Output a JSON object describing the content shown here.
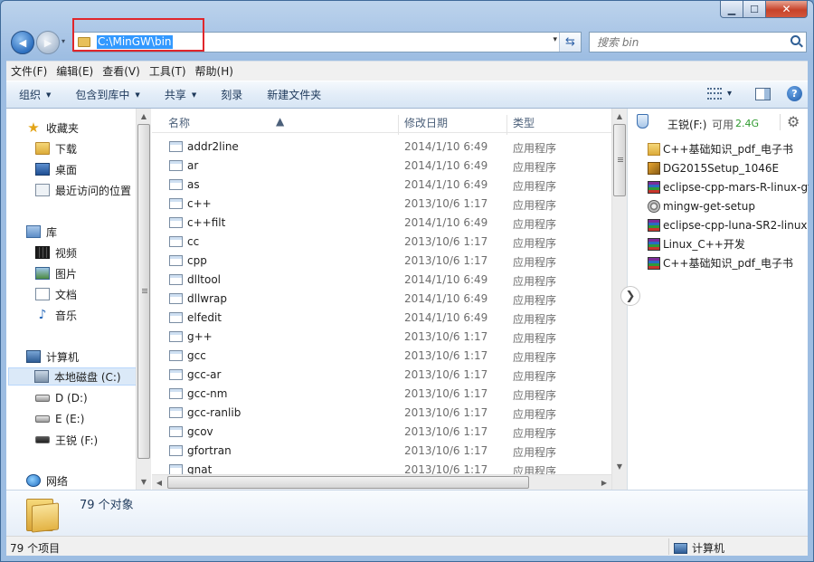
{
  "window": {
    "minimize": "▁",
    "maximize": "☐",
    "close": "✕"
  },
  "nav": {
    "back": "◀",
    "forward": "▶",
    "history": "▾",
    "address": "C:\\MinGW\\bin",
    "address_drop": "▾",
    "refresh": "⇆",
    "search_placeholder": "搜索 bin"
  },
  "menu": [
    "文件(F)",
    "编辑(E)",
    "查看(V)",
    "工具(T)",
    "帮助(H)"
  ],
  "commands": [
    {
      "label": "组织",
      "dropdown": true
    },
    {
      "label": "包含到库中",
      "dropdown": true
    },
    {
      "label": "共享",
      "dropdown": true
    },
    {
      "label": "刻录",
      "dropdown": false
    },
    {
      "label": "新建文件夹",
      "dropdown": false
    }
  ],
  "cmd_right": {
    "view_caret": "▾",
    "help": "?"
  },
  "navpane": {
    "favorites": "收藏夹",
    "downloads": "下载",
    "desktop": "桌面",
    "recent": "最近访问的位置",
    "libraries": "库",
    "videos": "视频",
    "pictures": "图片",
    "documents": "文档",
    "music": "音乐",
    "computer": "计算机",
    "drive_c": "本地磁盘 (C:)",
    "drive_d": "D (D:)",
    "drive_e": "E (E:)",
    "drive_f": "王锐 (F:)",
    "network": "网络"
  },
  "columns": {
    "name": "名称",
    "date": "修改日期",
    "type": "类型"
  },
  "files": [
    {
      "name": "addr2line",
      "date": "2014/1/10 6:49",
      "type": "应用程序"
    },
    {
      "name": "ar",
      "date": "2014/1/10 6:49",
      "type": "应用程序"
    },
    {
      "name": "as",
      "date": "2014/1/10 6:49",
      "type": "应用程序"
    },
    {
      "name": "c++",
      "date": "2013/10/6 1:17",
      "type": "应用程序"
    },
    {
      "name": "c++filt",
      "date": "2014/1/10 6:49",
      "type": "应用程序"
    },
    {
      "name": "cc",
      "date": "2013/10/6 1:17",
      "type": "应用程序"
    },
    {
      "name": "cpp",
      "date": "2013/10/6 1:17",
      "type": "应用程序"
    },
    {
      "name": "dlltool",
      "date": "2014/1/10 6:49",
      "type": "应用程序"
    },
    {
      "name": "dllwrap",
      "date": "2014/1/10 6:49",
      "type": "应用程序"
    },
    {
      "name": "elfedit",
      "date": "2014/1/10 6:49",
      "type": "应用程序"
    },
    {
      "name": "g++",
      "date": "2013/10/6 1:17",
      "type": "应用程序"
    },
    {
      "name": "gcc",
      "date": "2013/10/6 1:17",
      "type": "应用程序"
    },
    {
      "name": "gcc-ar",
      "date": "2013/10/6 1:17",
      "type": "应用程序"
    },
    {
      "name": "gcc-nm",
      "date": "2013/10/6 1:17",
      "type": "应用程序"
    },
    {
      "name": "gcc-ranlib",
      "date": "2013/10/6 1:17",
      "type": "应用程序"
    },
    {
      "name": "gcov",
      "date": "2013/10/6 1:17",
      "type": "应用程序"
    },
    {
      "name": "gfortran",
      "date": "2013/10/6 1:17",
      "type": "应用程序"
    },
    {
      "name": "gnat",
      "date": "2013/10/6 1:17",
      "type": "应用程序"
    }
  ],
  "preview": {
    "title": "王锐(F:)",
    "free_label": "可用",
    "free_size": "2.4G",
    "gear": "⚙",
    "expand": "❯",
    "items": [
      {
        "name": "C++基础知识_pdf_电子书",
        "icon": "folder-icon"
      },
      {
        "name": "DG2015Setup_1046E",
        "icon": "setup-icon"
      },
      {
        "name": "eclipse-cpp-mars-R-linux-gtk",
        "icon": "rar-icon"
      },
      {
        "name": "mingw-get-setup",
        "icon": "mingw-icon"
      },
      {
        "name": "eclipse-cpp-luna-SR2-linux",
        "icon": "rar-icon"
      },
      {
        "name": "Linux_C++开发",
        "icon": "rar-icon"
      },
      {
        "name": "C++基础知识_pdf_电子书",
        "icon": "rar-icon"
      }
    ]
  },
  "details": {
    "count": "79 个对象"
  },
  "status": {
    "items": "79 个项目",
    "location": "计算机"
  },
  "colors": {
    "accent": "#3399ff",
    "highlight_border": "#e0262b",
    "free_space": "#2f9a2f"
  }
}
